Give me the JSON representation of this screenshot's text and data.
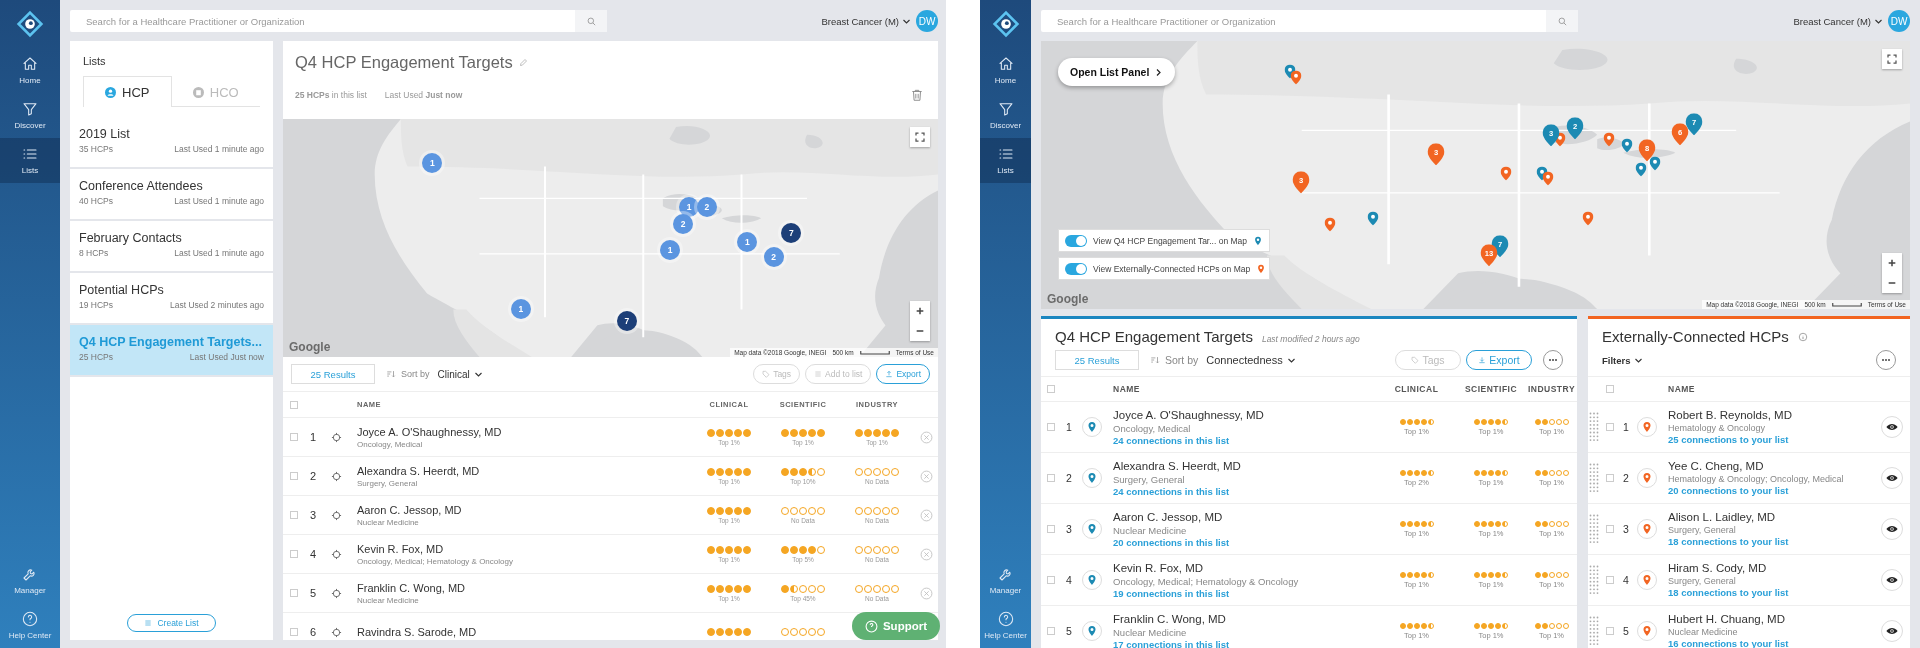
{
  "left_screen": {
    "sidebar": {
      "items": [
        {
          "label": "Home",
          "kind": "home",
          "selected": false
        },
        {
          "label": "Discover",
          "kind": "discover",
          "selected": false
        },
        {
          "label": "Lists",
          "kind": "lists",
          "selected": true
        }
      ],
      "bottom_items": [
        {
          "label": "Manager",
          "kind": "manager",
          "selected": false
        },
        {
          "label": "Help Center",
          "kind": "help",
          "selected": false
        }
      ]
    },
    "top_bar": {
      "search_placeholder": "Search for a Healthcare Practitioner or Organization",
      "context": "Breast Cancer (M)",
      "avatar": "DW"
    },
    "lists_panel": {
      "title": "Lists",
      "tabs": [
        {
          "label": "HCP",
          "selected": true
        },
        {
          "label": "HCO",
          "selected": false
        }
      ],
      "items": [
        {
          "name": "2019 List",
          "count": "35 HCPs",
          "last_used": "Last Used 1 minute ago",
          "selected": false
        },
        {
          "name": "Conference Attendees",
          "count": "40 HCPs",
          "last_used": "Last Used 1 minute ago",
          "selected": false
        },
        {
          "name": "February Contacts",
          "count": "8 HCPs",
          "last_used": "Last Used 1 minute ago",
          "selected": false
        },
        {
          "name": "Potential HCPs",
          "count": "19 HCPs",
          "last_used": "Last Used 2 minutes ago",
          "selected": false
        },
        {
          "name": "Q4 HCP Engagement Targets...",
          "count": "25 HCPs",
          "last_used": "Last Used Just now",
          "selected": true
        }
      ],
      "create_button": "Create List"
    },
    "list_detail": {
      "title": "Q4 HCP Engagement Targets",
      "meta": [
        "**25 HCPs** in this list",
        "Last Used **Just now**"
      ],
      "map": {
        "markers": [
          {
            "count": "1",
            "color": "#5b95e0"
          },
          {
            "count": "1",
            "color": "#5b95e0"
          },
          {
            "count": "2",
            "color": "#5b95e0"
          },
          {
            "count": "2",
            "color": "#5b95e0"
          },
          {
            "count": "1",
            "color": "#5b95e0"
          },
          {
            "count": "1",
            "color": "#5b95e0"
          },
          {
            "count": "7",
            "color": "#1d3f78"
          },
          {
            "count": "2",
            "color": "#5b95e0"
          },
          {
            "count": "1",
            "color": "#5b95e0"
          },
          {
            "count": "7",
            "color": "#1d3f78"
          }
        ],
        "logo": "Google",
        "attribution": "Map data ©2018 Google, INEGI",
        "scale": "500 km",
        "terms": "Terms of Use"
      },
      "toolbar": {
        "results": "25 Results",
        "sort_label": "Sort by",
        "sort_value": "Clinical",
        "buttons": [
          {
            "label": "Tags",
            "kind": "tags",
            "disabled": true
          },
          {
            "label": "Add to list",
            "kind": "add",
            "disabled": true
          },
          {
            "label": "Export",
            "kind": "export",
            "disabled": false
          }
        ]
      },
      "table": {
        "select_all_checked": false,
        "columns": [
          "NAME",
          "CLINICAL",
          "SCIENTIFIC",
          "INDUSTRY"
        ],
        "rows": [
          {
            "number": "1",
            "checked": false,
            "name": "Joyce A. O'Shaughnessy, MD",
            "specialty": "Oncology, Medical",
            "ratings": [
              {
                "stars": 5,
                "label": "Top 1%"
              },
              {
                "stars": 5,
                "label": "Top 1%"
              },
              {
                "stars": 5,
                "label": "Top 1%"
              }
            ]
          },
          {
            "number": "2",
            "checked": false,
            "name": "Alexandra S. Heerdt, MD",
            "specialty": "Surgery, General",
            "ratings": [
              {
                "stars": 5,
                "label": "Top 1%"
              },
              {
                "stars": 3.5,
                "label": "Top 10%"
              },
              {
                "stars": 0,
                "label": "No Data"
              }
            ]
          },
          {
            "number": "3",
            "checked": false,
            "name": "Aaron C. Jessop, MD",
            "specialty": "Nuclear Medicine",
            "ratings": [
              {
                "stars": 5,
                "label": "Top 1%"
              },
              {
                "stars": 0,
                "label": "No Data"
              },
              {
                "stars": 0,
                "label": "No Data"
              }
            ]
          },
          {
            "number": "4",
            "checked": false,
            "name": "Kevin R. Fox, MD",
            "specialty": "Oncology, Medical; Hematology & Oncology",
            "ratings": [
              {
                "stars": 5,
                "label": "Top 1%"
              },
              {
                "stars": 4,
                "label": "Top 5%"
              },
              {
                "stars": 0,
                "label": "No Data"
              }
            ]
          },
          {
            "number": "5",
            "checked": false,
            "name": "Franklin C. Wong, MD",
            "specialty": "Nuclear Medicine",
            "ratings": [
              {
                "stars": 5,
                "label": "Top 1%"
              },
              {
                "stars": 1.5,
                "label": "Top 45%"
              },
              {
                "stars": 0,
                "label": "No Data"
              }
            ]
          },
          {
            "number": "6",
            "checked": false,
            "name": "Ravindra S. Sarode, MD",
            "ratings": [
              {
                "stars": 5
              },
              {
                "stars": 0
              }
            ]
          }
        ]
      }
    },
    "support_button": "Support"
  },
  "right_screen": {
    "sidebar": {
      "items": [
        {
          "label": "Home",
          "kind": "home",
          "selected": false
        },
        {
          "label": "Discover",
          "kind": "discover",
          "selected": false
        },
        {
          "label": "Lists",
          "kind": "lists",
          "selected": true
        }
      ],
      "bottom_items": [
        {
          "label": "Manager",
          "kind": "manager",
          "selected": false
        },
        {
          "label": "Help Center",
          "kind": "help",
          "selected": false
        }
      ]
    },
    "top_bar": {
      "search_placeholder": "Search for a Healthcare Practitioner or Organization",
      "context": "Breast Cancer (M)",
      "avatar": "DW"
    },
    "map": {
      "open_panel_button": "Open List Panel",
      "toggles": [
        {
          "label": "View Q4 HCP Engagement Tar... on Map",
          "on": true,
          "color": "#1c8ab3"
        },
        {
          "label": "View Externally-Connected HCPs on Map",
          "on": true,
          "color": "#f26522"
        }
      ],
      "pins": [
        {
          "color": "#1c8ab3"
        },
        {
          "color": "#f26522"
        },
        {
          "count": "3",
          "color": "#f26522"
        },
        {
          "count": "3",
          "color": "#f26522"
        },
        {
          "color": "#f26522"
        },
        {
          "color": "#1c8ab3"
        },
        {
          "color": "#f26522"
        },
        {
          "count": "3",
          "color": "#1c8ab3"
        },
        {
          "color": "#f26522"
        },
        {
          "count": "2",
          "color": "#1c8ab3"
        },
        {
          "color": "#f26522"
        },
        {
          "color": "#1c8ab3"
        },
        {
          "count": "8",
          "color": "#f26522"
        },
        {
          "color": "#1c8ab3"
        },
        {
          "color": "#1c8ab3"
        },
        {
          "count": "6",
          "color": "#f26522"
        },
        {
          "count": "7",
          "color": "#1c8ab3"
        },
        {
          "color": "#f26522"
        },
        {
          "color": "#f26522"
        },
        {
          "color": "#1c8ab3"
        },
        {
          "count": "7",
          "color": "#1c8ab3"
        },
        {
          "count": "13",
          "color": "#f26522"
        }
      ],
      "logo": "Google",
      "attribution": "Map data ©2018 Google, INEGI",
      "scale": "500 km",
      "terms": "Terms of Use"
    },
    "list_panel": {
      "title": "Q4 HCP Engagement Targets",
      "subtitle": "Last modified 2 hours ago",
      "results": "25 Results",
      "sort_label": "Sort by",
      "sort_value": "Connectedness",
      "buttons": [
        {
          "label": "Tags",
          "kind": "tags",
          "disabled": true
        },
        {
          "label": "Export",
          "kind": "download",
          "disabled": false
        }
      ],
      "select_all_checked": false,
      "columns": [
        "NAME",
        "CLINICAL",
        "SCIENTIFIC",
        "INDUSTRY"
      ],
      "rows": [
        {
          "number": "1",
          "checked": false,
          "name": "Joyce A. O'Shaughnessy, MD",
          "specialty": "Oncology, Medical",
          "connections": "24 connections in this list",
          "ratings": [
            {
              "stars": 4.5,
              "label": "Top 1%"
            },
            {
              "stars": 4.5,
              "label": "Top 1%"
            },
            {
              "stars": 2,
              "label": "Top 1%"
            }
          ]
        },
        {
          "number": "2",
          "checked": false,
          "name": "Alexandra S. Heerdt, MD",
          "specialty": "Surgery, General",
          "connections": "24 connections in this list",
          "ratings": [
            {
              "stars": 4.5,
              "label": "Top 2%"
            },
            {
              "stars": 4.5,
              "label": "Top 1%"
            },
            {
              "stars": 2,
              "label": "Top 1%"
            }
          ]
        },
        {
          "number": "3",
          "checked": false,
          "name": "Aaron C. Jessop, MD",
          "specialty": "Nuclear Medicine",
          "connections": "20 connections in this list",
          "ratings": [
            {
              "stars": 4.5,
              "label": "Top 1%"
            },
            {
              "stars": 4.5,
              "label": "Top 1%"
            },
            {
              "stars": 2,
              "label": "Top 1%"
            }
          ]
        },
        {
          "number": "4",
          "checked": false,
          "name": "Kevin R. Fox, MD",
          "specialty": "Oncology, Medical; Hematology & Oncology",
          "connections": "19 connections in this list",
          "ratings": [
            {
              "stars": 4.5,
              "label": "Top 1%"
            },
            {
              "stars": 4.5,
              "label": "Top 1%"
            },
            {
              "stars": 2,
              "label": "Top 1%"
            }
          ]
        },
        {
          "number": "5",
          "checked": false,
          "name": "Franklin C. Wong, MD",
          "specialty": "Nuclear Medicine",
          "connections": "17 connections in this list",
          "ratings": [
            {
              "stars": 4.5,
              "label": "Top 1%"
            },
            {
              "stars": 4.5,
              "label": "Top 1%"
            },
            {
              "stars": 2,
              "label": "Top 1%"
            }
          ]
        }
      ]
    },
    "external_panel": {
      "title": "Externally-Connected HCPs",
      "filters": "Filters",
      "select_all_checked": false,
      "columns": [
        "NAME"
      ],
      "rows": [
        {
          "number": "1",
          "checked": false,
          "name": "Robert B. Reynolds, MD",
          "specialty": "Hematology & Oncology",
          "connections": "25 connections to your list"
        },
        {
          "number": "2",
          "checked": false,
          "name": "Yee C. Cheng, MD",
          "specialty": "Hematology & Oncology; Oncology, Medical",
          "connections": "20 connections to your list"
        },
        {
          "number": "3",
          "checked": false,
          "name": "Alison L. Laidley, MD",
          "specialty": "Surgery, General",
          "connections": "18 connections to your list"
        },
        {
          "number": "4",
          "checked": false,
          "name": "Hiram S. Cody, MD",
          "specialty": "Surgery, General",
          "connections": "18 connections to your list"
        },
        {
          "number": "5",
          "checked": false,
          "name": "Hubert H. Chuang, MD",
          "specialty": "Nuclear Medicine",
          "connections": "16 connections to your list"
        }
      ]
    }
  }
}
